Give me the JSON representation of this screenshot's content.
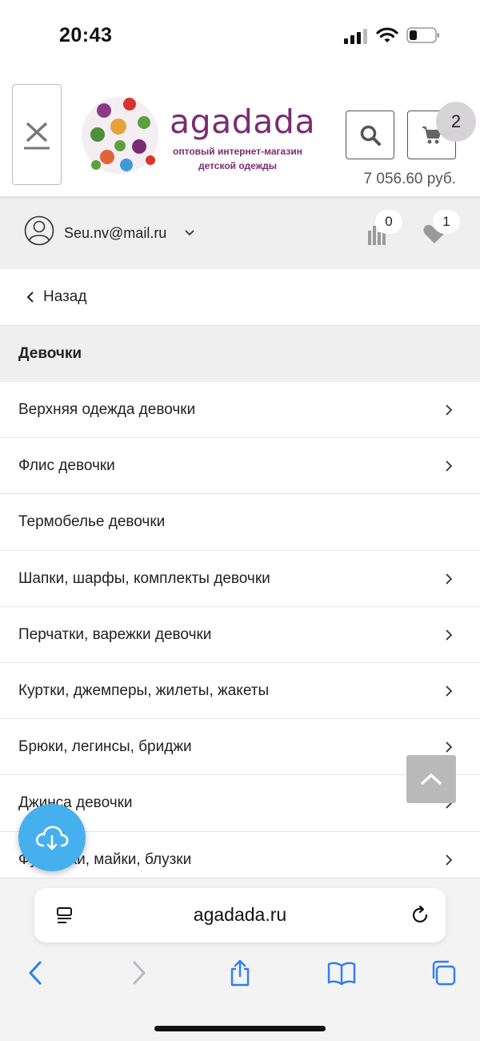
{
  "status_bar": {
    "time": "20:43"
  },
  "header": {
    "logo": {
      "name": "agadada",
      "tagline_line1": "оптовый интернет-магазин",
      "tagline_line2": "детской одежды"
    },
    "cart": {
      "count": "2",
      "total": "7 056.60 руб."
    }
  },
  "account": {
    "email": "Seu.nv@mail.ru",
    "compare_count": "0",
    "favorites_count": "1"
  },
  "menu": {
    "back_label": "Назад",
    "section_title": "Девочки",
    "items": [
      {
        "label": "Верхняя одежда девочки",
        "has_arrow": true
      },
      {
        "label": "Флис девочки",
        "has_arrow": true
      },
      {
        "label": "Термобелье девочки",
        "has_arrow": false
      },
      {
        "label": "Шапки, шарфы, комплекты девочки",
        "has_arrow": true
      },
      {
        "label": "Перчатки, варежки девочки",
        "has_arrow": true
      },
      {
        "label": "Куртки, джемперы, жилеты, жакеты",
        "has_arrow": true
      },
      {
        "label": "Брюки, легинсы, бриджи",
        "has_arrow": true
      },
      {
        "label": "Джинса девочки",
        "has_arrow": true
      },
      {
        "label": "Футболки, майки, блузки",
        "has_arrow": true
      }
    ]
  },
  "browser": {
    "url": "agadada.ru",
    "accent_color": "#2f7cf6"
  },
  "colors": {
    "brand": "#7a2c73",
    "fab": "#46b0ef"
  }
}
